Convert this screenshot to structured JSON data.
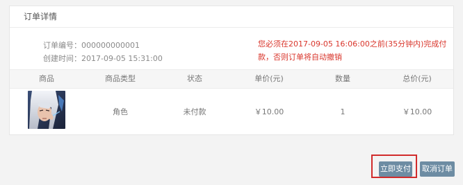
{
  "panel": {
    "title": "订单详情"
  },
  "order": {
    "number_label": "订单编号：",
    "number": "000000000001",
    "created_label": "创建时间：",
    "created": "2017-09-05 15:31:00",
    "warning": "您必须在2017-09-05 16:06:00之前(35分钟内)完成付款，否则订单将自动撤销"
  },
  "table": {
    "headers": [
      "商品",
      "商品类型",
      "状态",
      "单价(元)",
      "数量",
      "总价(元)"
    ],
    "rows": [
      {
        "product_image": "character-portrait",
        "type": "角色",
        "status": "未付款",
        "unit_price": "￥10.00",
        "quantity": "1",
        "total": "￥10.00"
      }
    ]
  },
  "actions": {
    "pay": "立即支付",
    "cancel": "取消订单"
  },
  "colors": {
    "warning": "#d9352b",
    "button": "#6d8ca3",
    "highlight": "#d12b2b"
  }
}
